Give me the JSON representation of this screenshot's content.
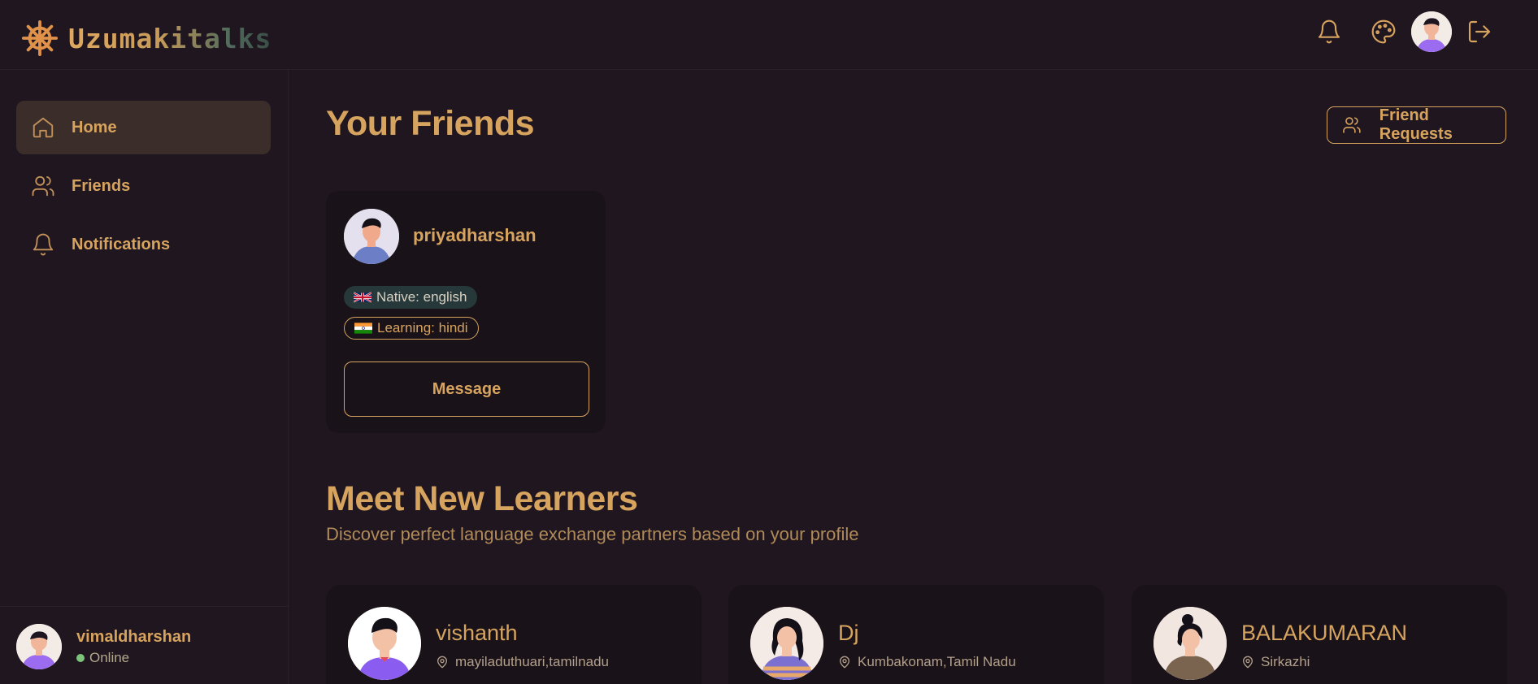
{
  "app": {
    "name": "Uzumakitalks"
  },
  "colors": {
    "accent": "#d7a45f",
    "background": "#1f161f",
    "card": "#1a1219",
    "online": "#7bc47a"
  },
  "topbar": {
    "icons": [
      "bell-icon",
      "palette-icon",
      "avatar",
      "logout-icon"
    ]
  },
  "sidebar": {
    "items": [
      {
        "label": "Home",
        "icon": "home-icon",
        "active": true
      },
      {
        "label": "Friends",
        "icon": "users-icon",
        "active": false
      },
      {
        "label": "Notifications",
        "icon": "bell-icon",
        "active": false
      }
    ],
    "user": {
      "name": "vimaldharshan",
      "status": "Online"
    }
  },
  "main": {
    "friends_title": "Your Friends",
    "friend_requests_label": "Friend Requests",
    "friends": [
      {
        "name": "priyadharshan",
        "native": "Native: english",
        "learning": "Learning: hindi",
        "message_label": "Message"
      }
    ],
    "learners_title": "Meet New Learners",
    "learners_subtitle": "Discover perfect language exchange partners based on your profile",
    "learners": [
      {
        "name": "vishanth",
        "location": "mayiladuthuari,tamilnadu"
      },
      {
        "name": "Dj",
        "location": "Kumbakonam,Tamil Nadu"
      },
      {
        "name": "BALAKUMARAN",
        "location": "Sirkazhi"
      }
    ]
  }
}
